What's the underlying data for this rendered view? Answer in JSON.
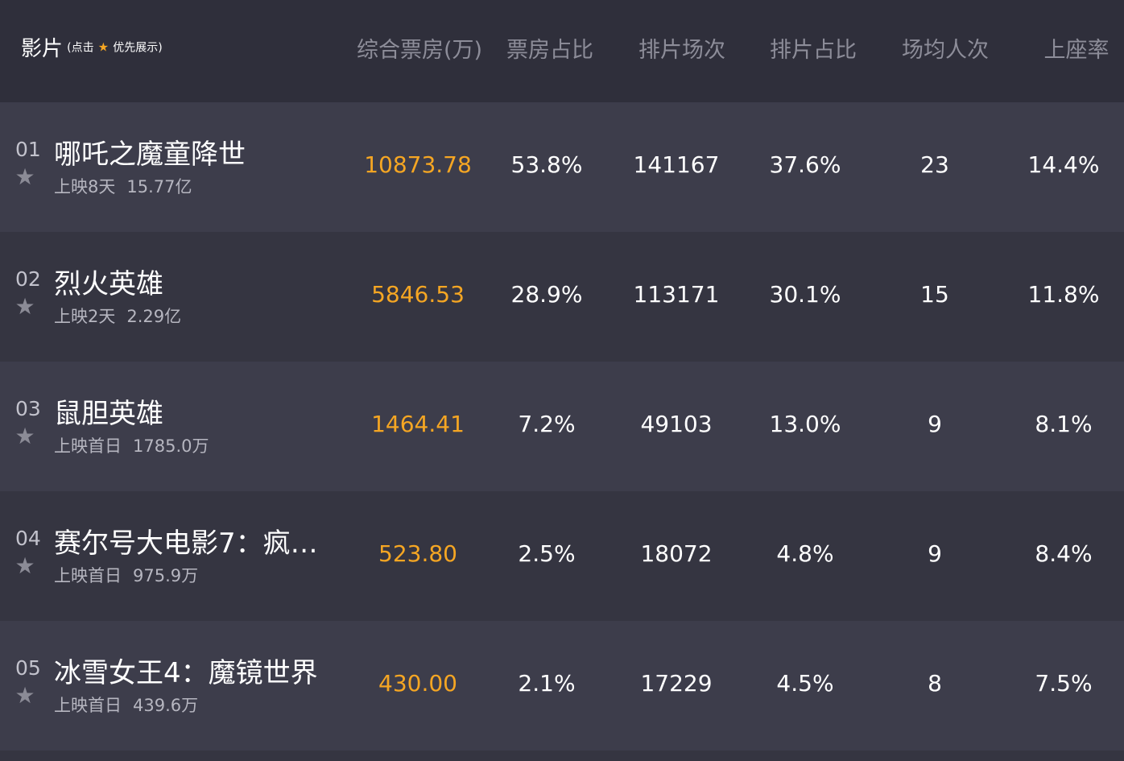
{
  "header": {
    "film_label": "影片",
    "note_open": "(点击",
    "note_close": "优先展示)",
    "columns": [
      "综合票房(万)",
      "票房占比",
      "排片场次",
      "排片占比",
      "场均人次",
      "上座率"
    ]
  },
  "colors": {
    "accent": "#f5a623",
    "row_dark": "#353541",
    "row_light": "#3d3d4b",
    "header": "#2f2f3b"
  },
  "icons": {
    "favorite": "star-icon"
  },
  "movies": [
    {
      "rank": "01",
      "title": "哪吒之魔童降世",
      "status": "上映8天",
      "total": "15.77亿",
      "box_office": "10873.78",
      "box_share": "53.8%",
      "screenings": "141167",
      "screen_share": "37.6%",
      "avg_viewers": "23",
      "occupancy": "14.4%"
    },
    {
      "rank": "02",
      "title": "烈火英雄",
      "status": "上映2天",
      "total": "2.29亿",
      "box_office": "5846.53",
      "box_share": "28.9%",
      "screenings": "113171",
      "screen_share": "30.1%",
      "avg_viewers": "15",
      "occupancy": "11.8%"
    },
    {
      "rank": "03",
      "title": "鼠胆英雄",
      "status": "上映首日",
      "total": "1785.0万",
      "box_office": "1464.41",
      "box_share": "7.2%",
      "screenings": "49103",
      "screen_share": "13.0%",
      "avg_viewers": "9",
      "occupancy": "8.1%"
    },
    {
      "rank": "04",
      "title": "赛尔号大电影7：疯…",
      "status": "上映首日",
      "total": "975.9万",
      "box_office": "523.80",
      "box_share": "2.5%",
      "screenings": "18072",
      "screen_share": "4.8%",
      "avg_viewers": "9",
      "occupancy": "8.4%"
    },
    {
      "rank": "05",
      "title": "冰雪女王4：魔镜世界",
      "status": "上映首日",
      "total": "439.6万",
      "box_office": "430.00",
      "box_share": "2.1%",
      "screenings": "17229",
      "screen_share": "4.5%",
      "avg_viewers": "8",
      "occupancy": "7.5%"
    }
  ]
}
